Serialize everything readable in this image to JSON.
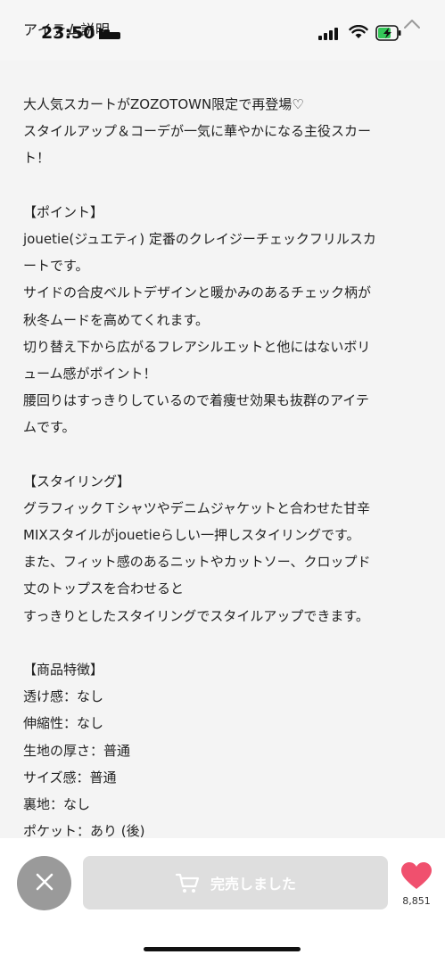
{
  "status_bar": {
    "time": "23:50"
  },
  "header": {
    "title": "アイテム説明"
  },
  "description": [
    "大人気スカートがZOZOTOWN限定で再登場♡",
    "スタイルアップ＆コーデが一気に華やかになる主役スカー",
    "ト！",
    "",
    "【ポイント】",
    "jouetie(ジュエティ) 定番のクレイジーチェックフリルスカ",
    "ートです。",
    "サイドの合皮ベルトデザインと暖かみのあるチェック柄が",
    "秋冬ムードを高めてくれます。",
    "切り替え下から広がるフレアシルエットと他にはないボリ",
    "ューム感がポイント！",
    "腰回りはすっきりしているので着痩せ効果も抜群のアイテ",
    "ムです。",
    "",
    "【スタイリング】",
    "グラフィックＴシャツやデニムジャケットと合わせた甘辛",
    "MIXスタイルがjouetieらしい一押しスタイリングです。",
    "また、フィット感のあるニットやカットソー、クロップド",
    "丈のトップスを合わせると",
    "すっきりとしたスタイリングでスタイルアップできます。",
    "",
    "【商品特徴】",
    "透け感：なし",
    "伸縮性：なし",
    "生地の厚さ：普通",
    "サイズ感：普通",
    "裏地：なし",
    "ポケット：あり (後)"
  ],
  "bottom_bar": {
    "soldout_label": "完売しました",
    "favorite_count": "8,851"
  },
  "colors": {
    "background": "#f4f4f4",
    "close_button": "#9a9a9a",
    "soldout_button": "#dedede",
    "heart": "#f0506e",
    "battery_fill": "#34c759"
  },
  "icons": [
    "sleep-icon",
    "signal-icon",
    "wifi-icon",
    "battery-icon",
    "chevron-up-icon",
    "close-icon",
    "cart-icon",
    "heart-icon"
  ]
}
